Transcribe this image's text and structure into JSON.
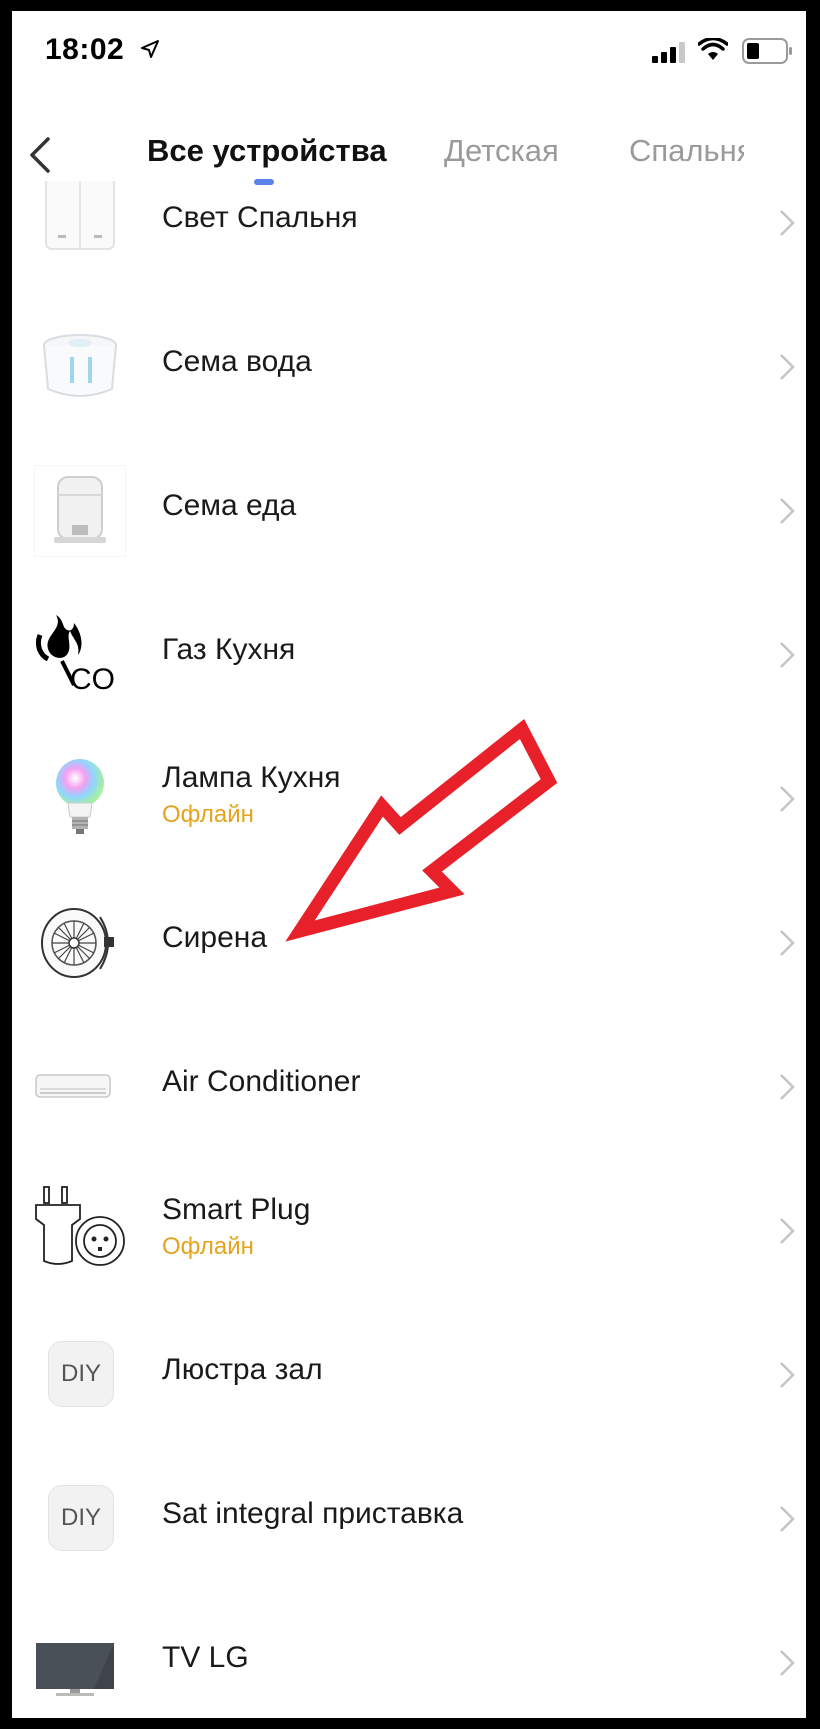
{
  "status_bar": {
    "time": "18:02"
  },
  "nav": {
    "tabs": [
      {
        "label": "Все устройства",
        "active": true
      },
      {
        "label": "Детская",
        "active": false
      },
      {
        "label": "Спальня",
        "active": false
      }
    ],
    "accent_color": "#5a82e8"
  },
  "devices": [
    {
      "name": "Свет Спальня",
      "status": "",
      "icon": "light-switch-icon"
    },
    {
      "name": "Сема вода",
      "status": "",
      "icon": "pet-water-fountain-icon"
    },
    {
      "name": "Сема еда",
      "status": "",
      "icon": "pet-feeder-icon"
    },
    {
      "name": "Газ Кухня",
      "status": "",
      "icon": "gas-co-detector-icon"
    },
    {
      "name": "Лампа Кухня",
      "status": "Офлайн",
      "icon": "bulb-icon"
    },
    {
      "name": "Сирена",
      "status": "",
      "icon": "siren-icon"
    },
    {
      "name": "Air Conditioner",
      "status": "",
      "icon": "air-conditioner-icon"
    },
    {
      "name": "Smart Plug",
      "status": "Офлайн",
      "icon": "smart-plug-icon"
    },
    {
      "name": "Люстра зал",
      "status": "",
      "icon": "diy-icon",
      "badge": "DIY"
    },
    {
      "name": "Sat integral приставка",
      "status": "",
      "icon": "diy-icon",
      "badge": "DIY"
    },
    {
      "name": "TV LG",
      "status": "",
      "icon": "tv-icon"
    }
  ],
  "colors": {
    "offline": "#e6a31d",
    "annotation_arrow": "#e8202a"
  }
}
